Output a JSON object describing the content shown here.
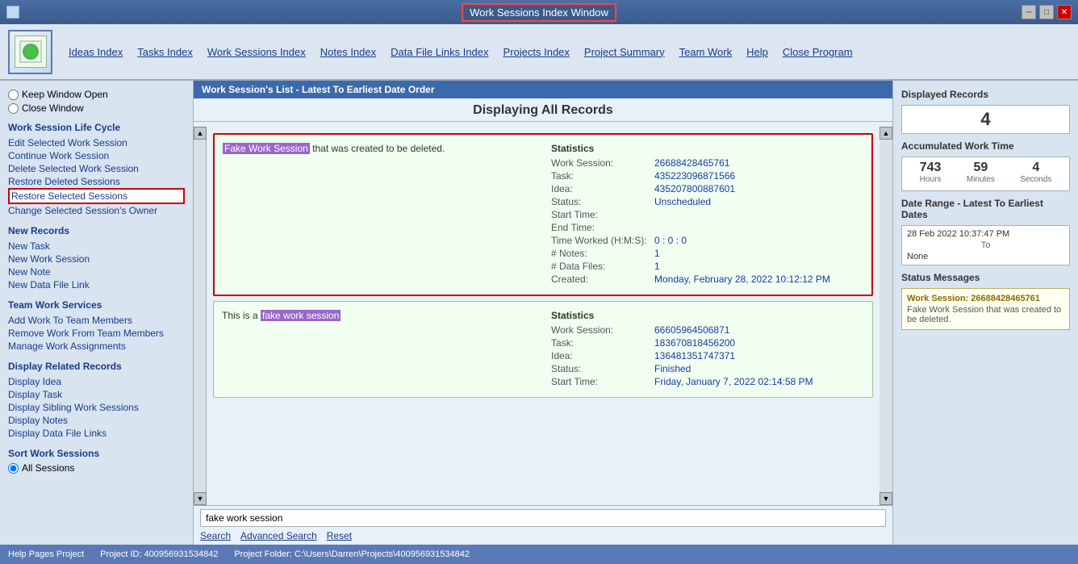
{
  "titleBar": {
    "title": "Work Sessions Index Window",
    "minimize": "─",
    "maximize": "□",
    "close": "✕"
  },
  "menuBar": {
    "items": [
      {
        "label": "Ideas Index",
        "key": "ideas-index"
      },
      {
        "label": "Tasks Index",
        "key": "tasks-index"
      },
      {
        "label": "Work Sessions Index",
        "key": "work-sessions-index"
      },
      {
        "label": "Notes Index",
        "key": "notes-index"
      },
      {
        "label": "Data File Links Index",
        "key": "data-file-links-index"
      },
      {
        "label": "Projects Index",
        "key": "projects-index"
      },
      {
        "label": "Project Summary",
        "key": "project-summary"
      },
      {
        "label": "Team Work",
        "key": "team-work"
      },
      {
        "label": "Help",
        "key": "help"
      },
      {
        "label": "Close Program",
        "key": "close-program"
      }
    ]
  },
  "sidebar": {
    "windowOptions": {
      "keepOpen": "Keep Window Open",
      "closeWindow": "Close Window"
    },
    "sections": [
      {
        "title": "Work Session Life Cycle",
        "links": [
          {
            "label": "Edit Selected Work Session",
            "key": "edit-selected",
            "highlighted": false
          },
          {
            "label": "Continue Work Session",
            "key": "continue-work",
            "highlighted": false
          },
          {
            "label": "Delete Selected Work Session",
            "key": "delete-selected",
            "highlighted": false
          },
          {
            "label": "Restore Deleted Sessions",
            "key": "restore-deleted",
            "highlighted": false
          },
          {
            "label": "Restore Selected Sessions",
            "key": "restore-selected",
            "highlighted": true
          },
          {
            "label": "Change Selected Session's Owner",
            "key": "change-owner",
            "highlighted": false
          }
        ]
      },
      {
        "title": "New Records",
        "links": [
          {
            "label": "New Task",
            "key": "new-task",
            "highlighted": false
          },
          {
            "label": "New Work Session",
            "key": "new-work-session",
            "highlighted": false
          },
          {
            "label": "New Note",
            "key": "new-note",
            "highlighted": false
          },
          {
            "label": "New Data File Link",
            "key": "new-data-file-link",
            "highlighted": false
          }
        ]
      },
      {
        "title": "Team Work Services",
        "links": [
          {
            "label": "Add Work To Team Members",
            "key": "add-work-team",
            "highlighted": false
          },
          {
            "label": "Remove Work From Team Members",
            "key": "remove-work-team",
            "highlighted": false
          },
          {
            "label": "Manage Work Assignments",
            "key": "manage-assignments",
            "highlighted": false
          }
        ]
      },
      {
        "title": "Display Related Records",
        "links": [
          {
            "label": "Display Idea",
            "key": "display-idea",
            "highlighted": false
          },
          {
            "label": "Display Task",
            "key": "display-task",
            "highlighted": false
          },
          {
            "label": "Display Sibling Work Sessions",
            "key": "display-sibling",
            "highlighted": false
          },
          {
            "label": "Display Notes",
            "key": "display-notes",
            "highlighted": false
          },
          {
            "label": "Display Data File Links",
            "key": "display-data-file-links",
            "highlighted": false
          }
        ]
      },
      {
        "title": "Sort Work Sessions",
        "links": [
          {
            "label": "All Sessions",
            "key": "all-sessions",
            "highlighted": false,
            "isRadio": true
          }
        ]
      }
    ]
  },
  "contentArea": {
    "listHeader": "Work Session's List - Latest To Earliest Date Order",
    "displayingHeader": "Displaying All Records",
    "records": [
      {
        "id": "record-1",
        "selected": true,
        "descriptionParts": [
          {
            "text": "Fake Work Session",
            "highlighted": true
          },
          {
            "text": " that was created to be deleted.",
            "highlighted": false
          }
        ],
        "stats": {
          "title": "Statistics",
          "rows": [
            {
              "label": "Work Session:",
              "value": "26688428465761"
            },
            {
              "label": "Task:",
              "value": "435223096871566"
            },
            {
              "label": "Idea:",
              "value": "435207800887601"
            },
            {
              "label": "Status:",
              "value": "Unscheduled"
            },
            {
              "label": "Start Time:",
              "value": ""
            },
            {
              "label": "End Time:",
              "value": ""
            },
            {
              "label": "Time Worked (H:M:S):",
              "value": "0 : 0 : 0"
            },
            {
              "label": "# Notes:",
              "value": "1"
            },
            {
              "label": "# Data Files:",
              "value": "1"
            },
            {
              "label": "Created:",
              "value": "Monday, February 28, 2022  10:12:12 PM"
            }
          ]
        }
      },
      {
        "id": "record-2",
        "selected": false,
        "descriptionParts": [
          {
            "text": "This is a ",
            "highlighted": false
          },
          {
            "text": "fake work session",
            "highlighted": true
          }
        ],
        "stats": {
          "title": "Statistics",
          "rows": [
            {
              "label": "Work Session:",
              "value": "66605964506871"
            },
            {
              "label": "Task:",
              "value": "183670818456200"
            },
            {
              "label": "Idea:",
              "value": "136481351747371"
            },
            {
              "label": "Status:",
              "value": "Finished"
            },
            {
              "label": "Start Time:",
              "value": "Friday, January 7, 2022  02:14:58 PM"
            }
          ]
        }
      }
    ],
    "searchBar": {
      "placeholder": "fake work session",
      "searchLabel": "Search",
      "advancedSearchLabel": "Advanced Search",
      "resetLabel": "Reset"
    }
  },
  "rightPanel": {
    "displayedRecords": {
      "title": "Displayed Records",
      "count": "4"
    },
    "accumulatedWorkTime": {
      "title": "Accumulated Work Time",
      "hours": "743",
      "hoursLabel": "Hours",
      "minutes": "59",
      "minutesLabel": "Minutes",
      "seconds": "4",
      "secondsLabel": "Seconds"
    },
    "dateRange": {
      "title": "Date Range - Latest To Earliest Dates",
      "from": "28 Feb 2022  10:37:47 PM",
      "to": "To",
      "toValue": "None"
    },
    "statusMessages": {
      "title": "Status Messages",
      "sessionId": "Work Session: 26688428465761",
      "description": "Fake Work Session that was created to be deleted."
    }
  },
  "statusBar": {
    "helpPages": "Help Pages Project",
    "projectId": "Project ID:  400956931534842",
    "projectFolder": "Project Folder: C:\\Users\\Darren\\Projects\\400956931534842"
  }
}
